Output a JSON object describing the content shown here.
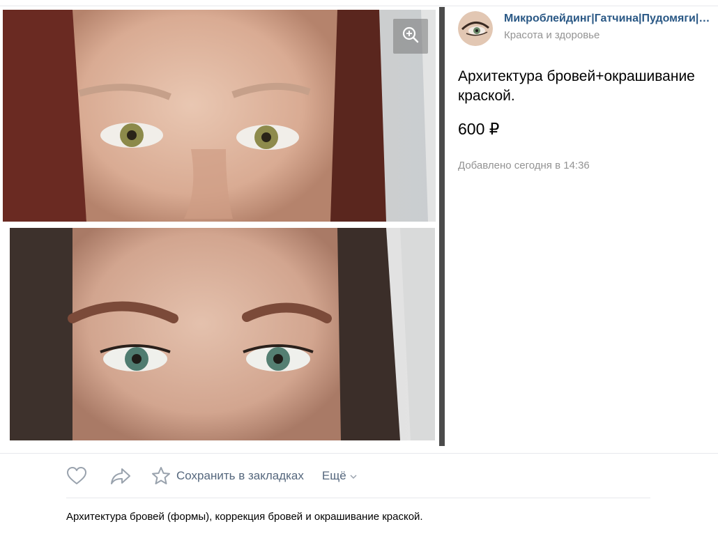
{
  "group": {
    "name": "Микроблейдинг|Гатчина|Пудомяги|Пу...",
    "category": "Красота и здоровье"
  },
  "product": {
    "title": "Архитектура бровей+окрашивание краской.",
    "price": "600 ₽",
    "added": "Добавлено сегодня в 14:36",
    "description": "Архитектура бровей (формы), коррекция бровей и окрашивание краской."
  },
  "actions": {
    "like_icon": "heart-icon",
    "share_icon": "share-arrow-icon",
    "bookmark_icon": "star-icon",
    "save_label": "Сохранить в закладках",
    "more_label": "Ещё"
  },
  "photo": {
    "zoom_icon": "zoom-in-icon"
  },
  "colors": {
    "link": "#2a5885",
    "muted": "#939393",
    "action": "#55677d",
    "divider": "#e7e8ec"
  }
}
